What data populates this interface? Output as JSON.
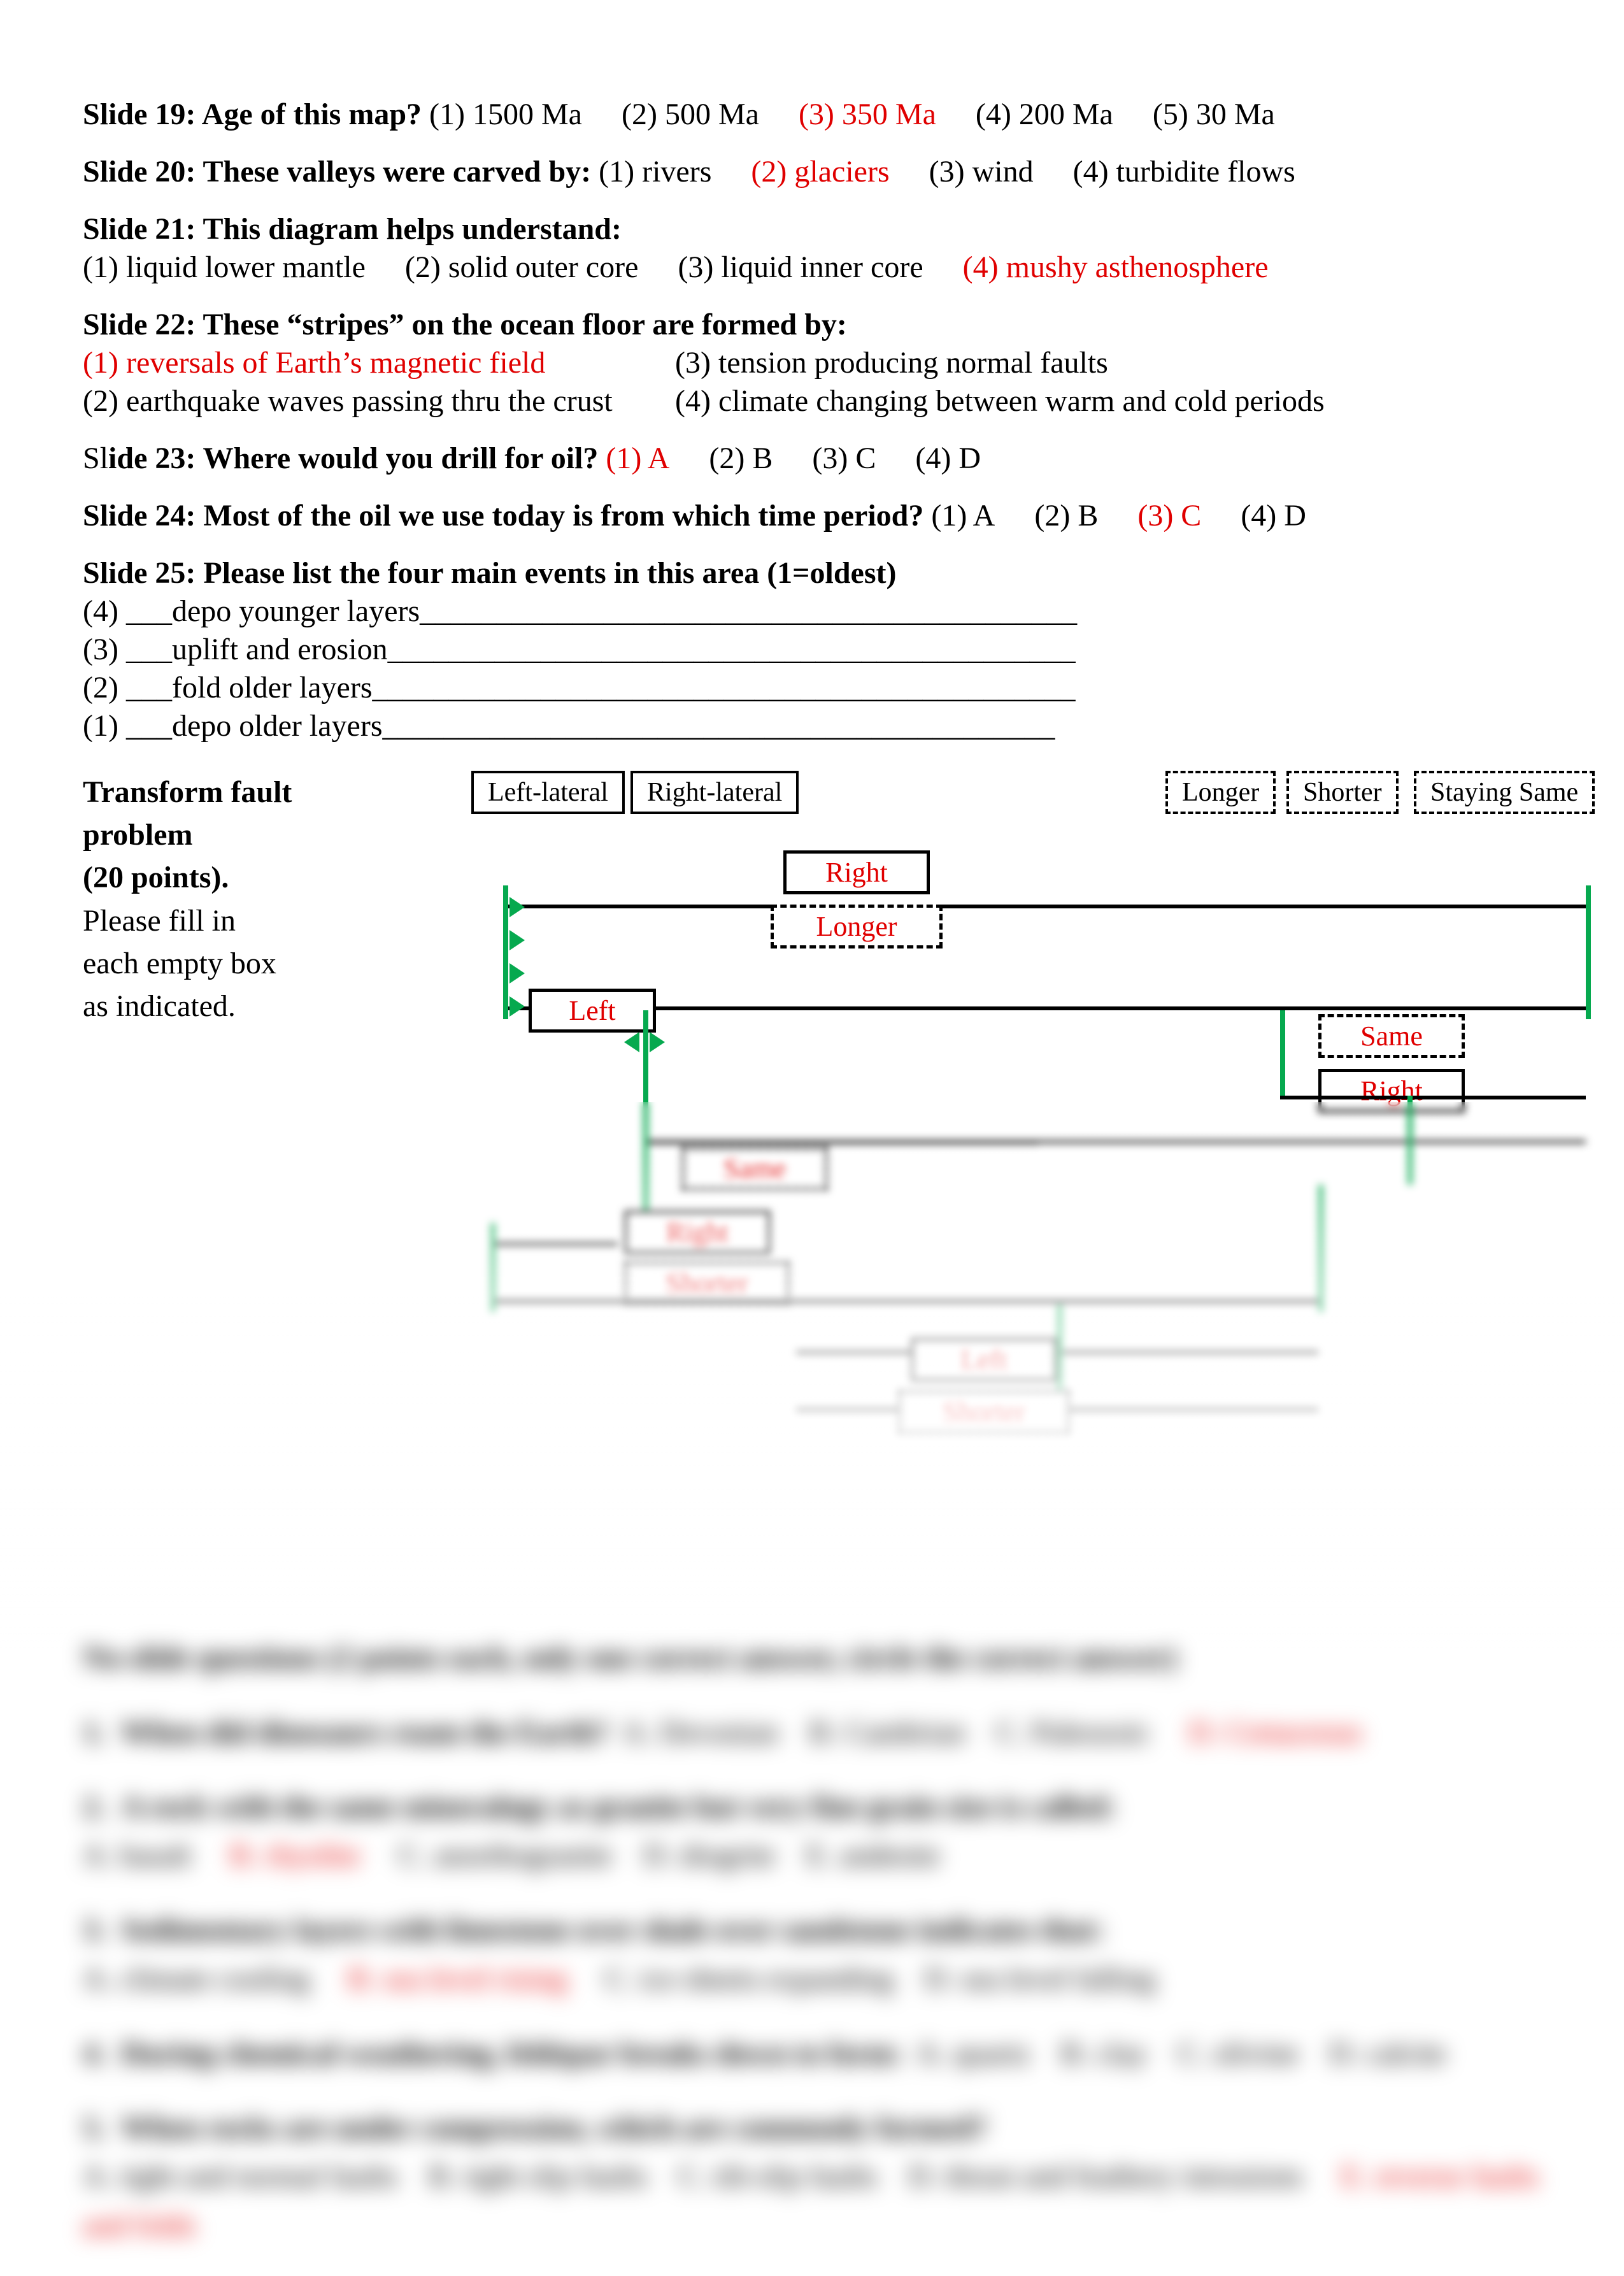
{
  "q19": {
    "prompt": "Slide 19: Age of this map?",
    "opts": [
      "(1) 1500 Ma",
      "(2) 500 Ma",
      "(3) 350 Ma",
      "(4) 200 Ma",
      "(5) 30 Ma"
    ],
    "correct_index": 2
  },
  "q20": {
    "prompt": "Slide 20: These valleys were carved by:",
    "opts": [
      "(1) rivers",
      "(2) glaciers",
      "(3) wind",
      "(4) turbidite flows"
    ],
    "correct_index": 1
  },
  "q21": {
    "prompt": "Slide 21: This diagram helps understand:",
    "opts": [
      "(1) liquid lower mantle",
      "(2) solid outer core",
      "(3) liquid inner core",
      "(4) mushy asthenosphere"
    ],
    "correct_index": 3
  },
  "q22": {
    "prompt": "Slide 22: These “stripes” on the ocean floor are formed by:",
    "col1": [
      "(1) reversals of Earth’s magnetic field",
      "(2) earthquake waves passing thru the crust"
    ],
    "col2": [
      "(3) tension producing normal faults",
      "(4) climate changing between warm and cold periods"
    ],
    "correct_col1_index": 0
  },
  "q23": {
    "prefix": "Sl",
    "prompt_rest": "ide 23: Where would you drill for oil?",
    "opts": [
      "(1) A",
      "(2) B",
      "(3) C",
      "(4) D"
    ],
    "correct_index": 0
  },
  "q24": {
    "prompt": "Slide 24: Most of the oil we use today is from which time period?",
    "opts": [
      "(1) A",
      "(2) B",
      "(3) C",
      "(4) D"
    ],
    "correct_index": 2
  },
  "q25": {
    "prompt": "Slide 25: Please list the four main events in this area (1=oldest)",
    "lines": [
      "(4) ___depo younger layers___________________________________________",
      "(3) ___uplift and erosion_____________________________________________",
      "(2) ___fold older layers______________________________________________",
      "(1) ___depo older layers____________________________________________"
    ]
  },
  "tf": {
    "title_line1": "Transform fault",
    "title_line2": "problem",
    "title_line3": "(20 points).",
    "instr_line1": "Please fill in",
    "instr_line2": "each empty box",
    "instr_line3": "as indicated.",
    "header_left": [
      "Left-lateral",
      "Right-lateral"
    ],
    "header_right": [
      "Longer",
      "Shorter",
      "Staying Same"
    ],
    "answers": {
      "box1_solid": "Right",
      "box1_dash": "Longer",
      "box2_solid": "Left",
      "box3_dash": "Same",
      "box3_solid": "Right",
      "box4_dash": "Same",
      "box4_solid": "Right",
      "box4b_dash": "Shorter",
      "box5_solid": "Left",
      "box5_dash": "Shorter"
    }
  },
  "blurred": {
    "heading": "No-slide questions (2 points each, only one correct answer, circle the correct answer)",
    "items": [
      {
        "n": "1.",
        "q": "When did dinosaurs roam the Earth?",
        "opts": "A. Devonian B. Cambrian C. Paleozoic ",
        "ans": "D. Cretaceous"
      },
      {
        "n": "2.",
        "q": "A rock with the same mineralogy as granite but very fine grain size is called:",
        "opts": "A. basalt ",
        "ans": "B. rhyolite",
        "opts2": " C. anorthogranite D. diogrite E. andesite"
      },
      {
        "n": "3.",
        "q": "Sedimentary layers with limestone over shale over sandstone indicates that:",
        "opts": "A. climate cooling ",
        "ans": "B. sea level rising",
        "opts2": " C. ice sheets expanding D. sea level falling"
      },
      {
        "n": "4.",
        "q": "During chemical weathering, feldspar breaks down to form:",
        "opts": "A. quartz B. clay C. olivine D. calcite",
        "ans": ""
      },
      {
        "n": "5.",
        "q": "When rocks are under compression, which are commonly formed?",
        "opts": "A. tight and normal faults B. tight slip faults C. tilt-slip faults D. thrust and feathery intrusions ",
        "ans": "E. reverse faults and folds"
      }
    ]
  }
}
